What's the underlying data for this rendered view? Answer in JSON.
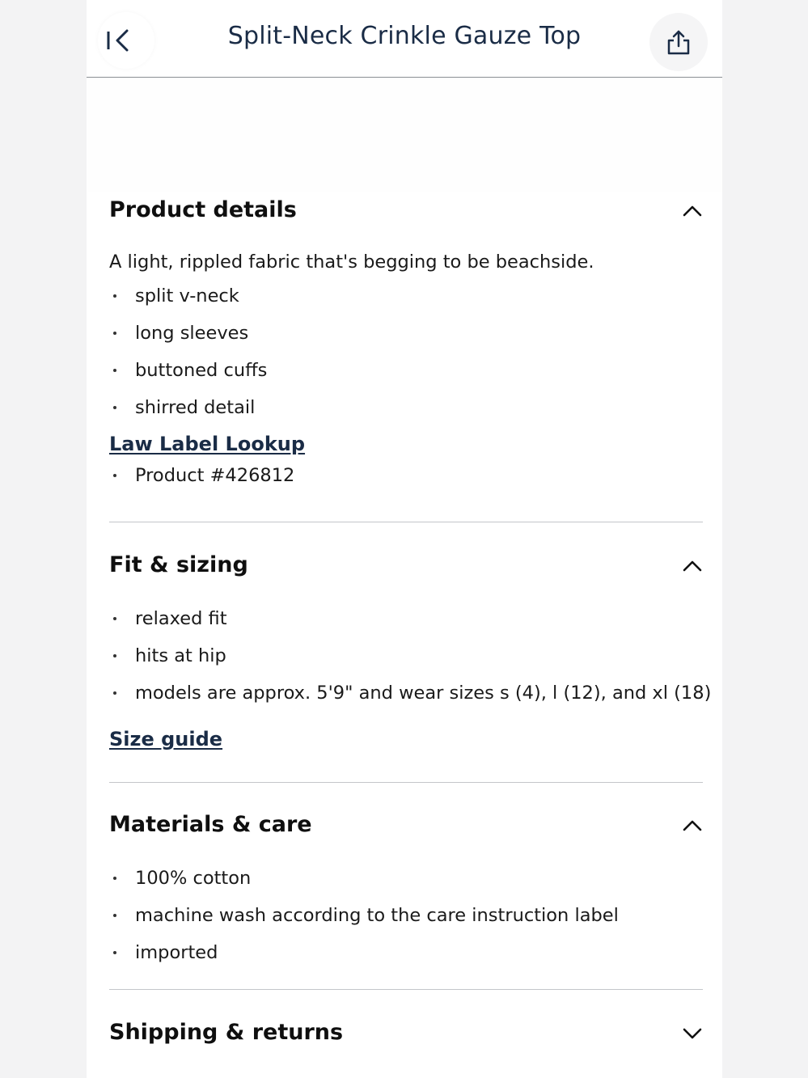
{
  "header": {
    "title": "Split-Neck Crinkle Gauze Top",
    "back_icon": "back-to-start-icon",
    "share_icon": "share-icon"
  },
  "sections": {
    "product_details": {
      "title": "Product details",
      "expanded": true,
      "description": "A light, rippled fabric that's begging to be beachside.",
      "bullets": [
        "split v-neck",
        "long sleeves",
        "buttoned cuffs",
        "shirred detail"
      ],
      "link": "Law Label Lookup",
      "product_number": "Product #426812"
    },
    "fit_sizing": {
      "title": "Fit & sizing",
      "expanded": true,
      "bullets": [
        "relaxed fit",
        "hits at hip",
        "models are approx. 5'9\" and wear sizes s (4), l (12), and xl (18)"
      ],
      "link": "Size guide"
    },
    "materials_care": {
      "title": "Materials & care",
      "expanded": true,
      "bullets": [
        "100% cotton",
        "machine wash according to the care instruction label",
        "imported"
      ]
    },
    "shipping_returns": {
      "title": "Shipping & returns",
      "expanded": false
    }
  },
  "colors": {
    "link": "#1a2c46",
    "divider": "#c4c6ca",
    "background": "#f3f3f4"
  }
}
